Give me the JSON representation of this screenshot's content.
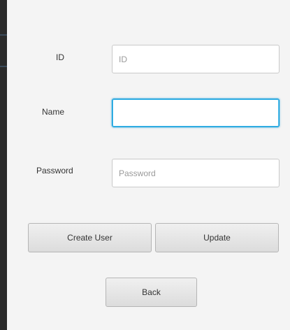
{
  "form": {
    "id": {
      "label": "ID",
      "value": "",
      "placeholder": "ID"
    },
    "name": {
      "label": "Name",
      "value": "",
      "placeholder": "",
      "focused": true
    },
    "password": {
      "label": "Password",
      "value": "",
      "placeholder": "Password"
    }
  },
  "buttons": {
    "create_user": "Create User",
    "update": "Update",
    "back": "Back"
  },
  "colors": {
    "focus_accent": "#0096d6",
    "window_background": "#f4f4f4",
    "side_strip": "#2a2a2a"
  }
}
